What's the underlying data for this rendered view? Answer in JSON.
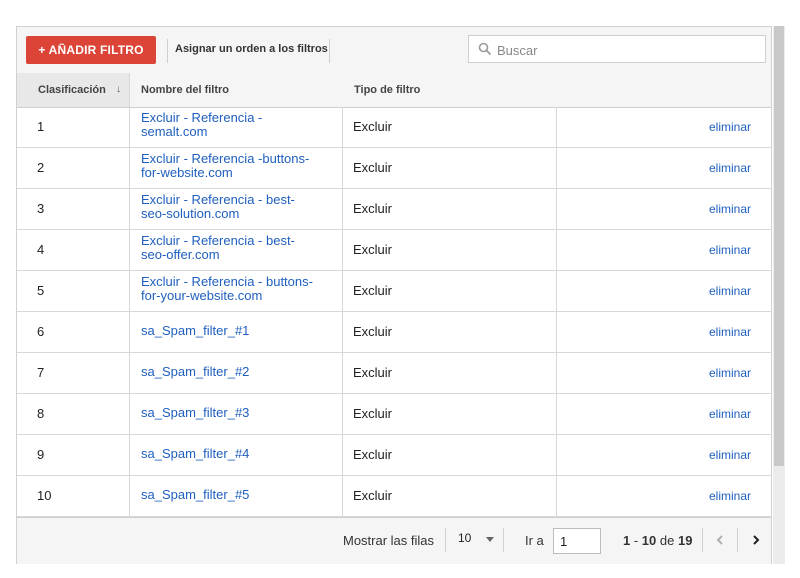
{
  "toolbar": {
    "add_filter_label": "+ AÑADIR FILTRO",
    "order_label": "Asignar un orden a los filtros",
    "search_placeholder": "Buscar"
  },
  "table": {
    "columns": [
      "Clasificación",
      "Nombre del filtro",
      "Tipo de filtro"
    ],
    "sort_indicator": "↓",
    "delete_label": "eliminar",
    "rows": [
      {
        "rank": "1",
        "name_line1": "Excluir - Referencia -",
        "name_line2": "semalt.com",
        "type": "Excluir"
      },
      {
        "rank": "2",
        "name_line1": "Excluir - Referencia -buttons-",
        "name_line2": "for-website.com",
        "type": "Excluir"
      },
      {
        "rank": "3",
        "name_line1": "Excluir - Referencia - best-",
        "name_line2": "seo-solution.com",
        "type": "Excluir"
      },
      {
        "rank": "4",
        "name_line1": "Excluir - Referencia - best-",
        "name_line2": "seo-offer.com",
        "type": "Excluir"
      },
      {
        "rank": "5",
        "name_line1": "Excluir - Referencia - buttons-",
        "name_line2": "for-your-website.com",
        "type": "Excluir"
      },
      {
        "rank": "6",
        "name_line1": "sa_Spam_filter_#1",
        "name_line2": "",
        "type": "Excluir"
      },
      {
        "rank": "7",
        "name_line1": "sa_Spam_filter_#2",
        "name_line2": "",
        "type": "Excluir"
      },
      {
        "rank": "8",
        "name_line1": "sa_Spam_filter_#3",
        "name_line2": "",
        "type": "Excluir"
      },
      {
        "rank": "9",
        "name_line1": "sa_Spam_filter_#4",
        "name_line2": "",
        "type": "Excluir"
      },
      {
        "rank": "10",
        "name_line1": "sa_Spam_filter_#5",
        "name_line2": "",
        "type": "Excluir"
      }
    ]
  },
  "footer": {
    "show_rows_label": "Mostrar las filas",
    "rows_per_page": "10",
    "goto_label": "Ir a",
    "goto_value": "1",
    "range_start": "1",
    "range_end": "10",
    "range_of": "de",
    "total": "19"
  },
  "icons": {
    "search": "search-icon",
    "sort": "sort-down-icon",
    "dropdown": "chevron-down-icon",
    "prev": "chevron-left-icon",
    "next": "chevron-right-icon"
  },
  "colors": {
    "accent_red": "#db4437",
    "link_blue": "#1f5fbf"
  }
}
